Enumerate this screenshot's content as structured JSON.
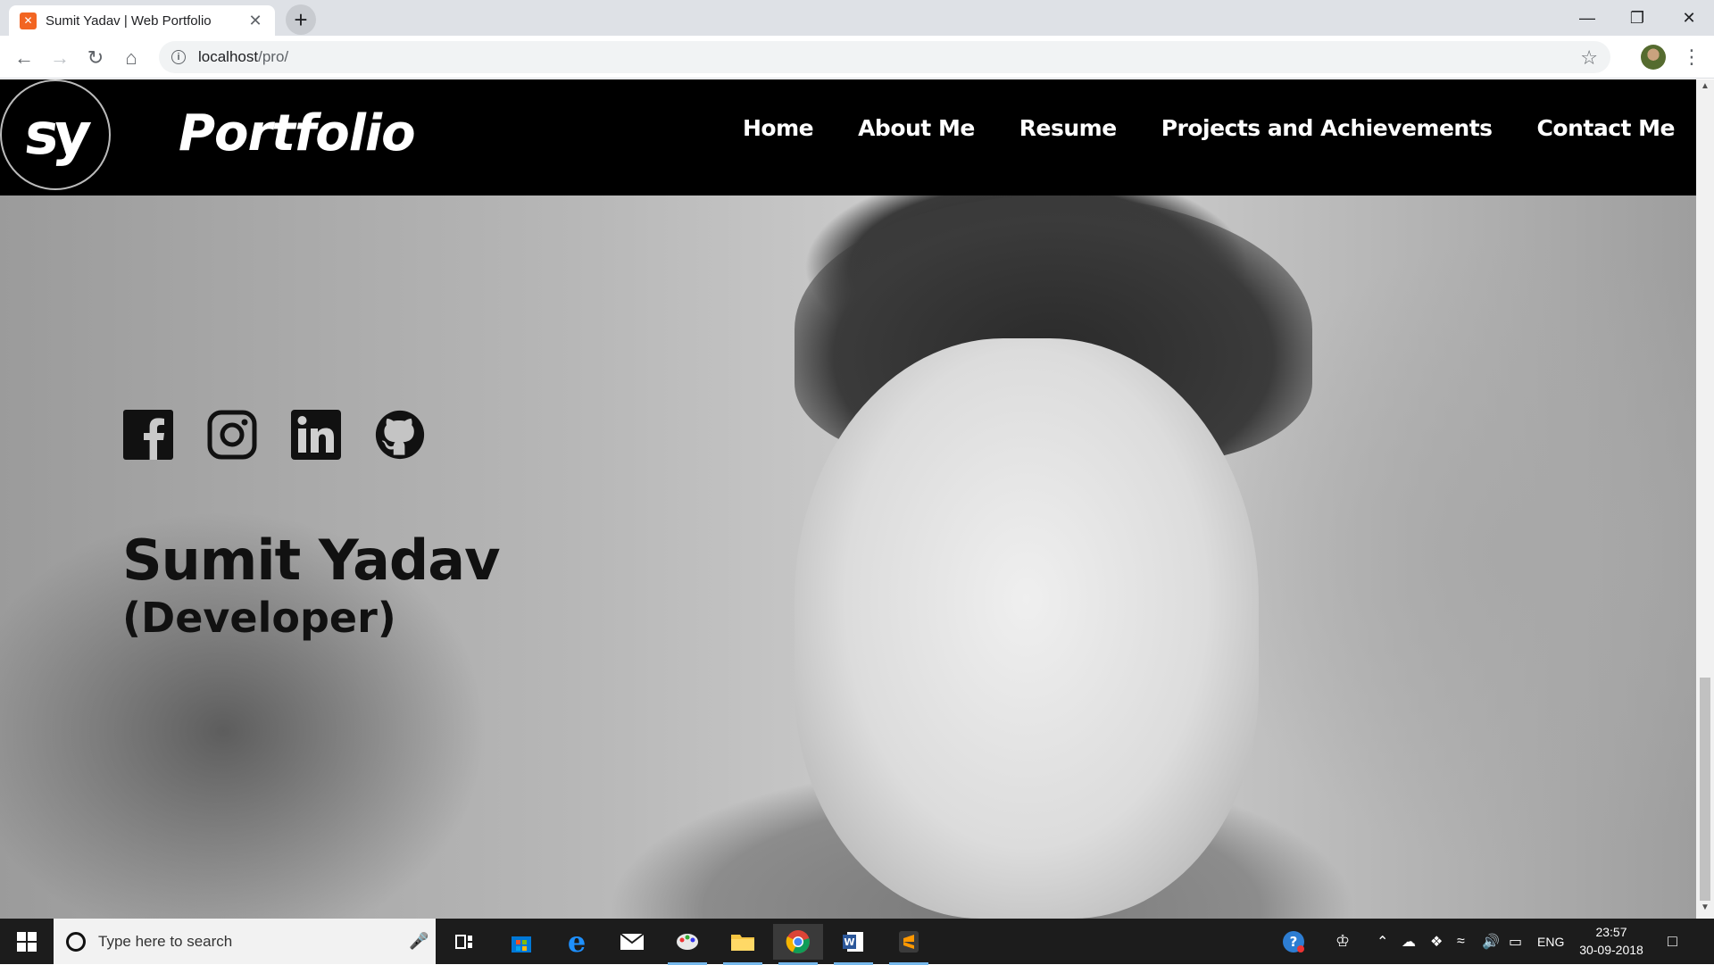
{
  "browser": {
    "tab_title": "Sumit Yadav | Web Portfolio",
    "url_host": "localhost",
    "url_path": "/pro/"
  },
  "site": {
    "logo_text": "sy",
    "brand": "Portfolio",
    "nav": [
      "Home",
      "About Me",
      "Resume",
      "Projects and Achievements",
      "Contact Me"
    ]
  },
  "hero": {
    "social": [
      "facebook-icon",
      "instagram-icon",
      "linkedin-icon",
      "github-icon"
    ],
    "name": "Sumit Yadav",
    "role": "(Developer)"
  },
  "taskbar": {
    "search_placeholder": "Type here to search",
    "language": "ENG",
    "time": "23:57",
    "date": "30-09-2018"
  },
  "colors": {
    "header_bg": "#000000",
    "nav_text": "#ffffff",
    "hero_text": "#111111"
  }
}
